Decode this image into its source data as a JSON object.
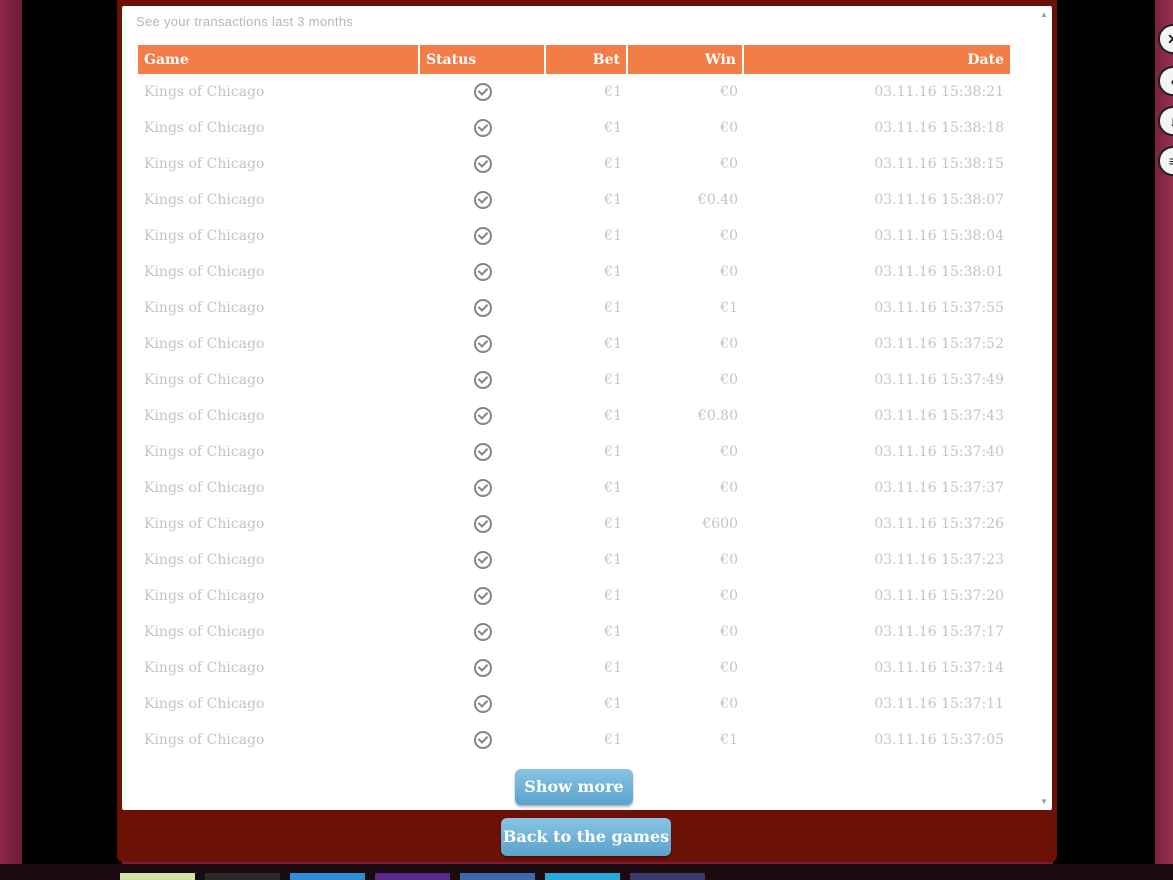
{
  "subtitle": "See your transactions last 3 months",
  "columns": {
    "game": "Game",
    "status": "Status",
    "bet": "Bet",
    "win": "Win",
    "date": "Date"
  },
  "rows": [
    {
      "game": "Kings of Chicago",
      "bet": "€1",
      "win": "€0",
      "date": "03.11.16 15:38:21"
    },
    {
      "game": "Kings of Chicago",
      "bet": "€1",
      "win": "€0",
      "date": "03.11.16 15:38:18"
    },
    {
      "game": "Kings of Chicago",
      "bet": "€1",
      "win": "€0",
      "date": "03.11.16 15:38:15"
    },
    {
      "game": "Kings of Chicago",
      "bet": "€1",
      "win": "€0.40",
      "date": "03.11.16 15:38:07"
    },
    {
      "game": "Kings of Chicago",
      "bet": "€1",
      "win": "€0",
      "date": "03.11.16 15:38:04"
    },
    {
      "game": "Kings of Chicago",
      "bet": "€1",
      "win": "€0",
      "date": "03.11.16 15:38:01"
    },
    {
      "game": "Kings of Chicago",
      "bet": "€1",
      "win": "€1",
      "date": "03.11.16 15:37:55"
    },
    {
      "game": "Kings of Chicago",
      "bet": "€1",
      "win": "€0",
      "date": "03.11.16 15:37:52"
    },
    {
      "game": "Kings of Chicago",
      "bet": "€1",
      "win": "€0",
      "date": "03.11.16 15:37:49"
    },
    {
      "game": "Kings of Chicago",
      "bet": "€1",
      "win": "€0.80",
      "date": "03.11.16 15:37:43"
    },
    {
      "game": "Kings of Chicago",
      "bet": "€1",
      "win": "€0",
      "date": "03.11.16 15:37:40"
    },
    {
      "game": "Kings of Chicago",
      "bet": "€1",
      "win": "€0",
      "date": "03.11.16 15:37:37"
    },
    {
      "game": "Kings of Chicago",
      "bet": "€1",
      "win": "€600",
      "date": "03.11.16 15:37:26"
    },
    {
      "game": "Kings of Chicago",
      "bet": "€1",
      "win": "€0",
      "date": "03.11.16 15:37:23"
    },
    {
      "game": "Kings of Chicago",
      "bet": "€1",
      "win": "€0",
      "date": "03.11.16 15:37:20"
    },
    {
      "game": "Kings of Chicago",
      "bet": "€1",
      "win": "€0",
      "date": "03.11.16 15:37:17"
    },
    {
      "game": "Kings of Chicago",
      "bet": "€1",
      "win": "€0",
      "date": "03.11.16 15:37:14"
    },
    {
      "game": "Kings of Chicago",
      "bet": "€1",
      "win": "€0",
      "date": "03.11.16 15:37:11"
    },
    {
      "game": "Kings of Chicago",
      "bet": "€1",
      "win": "€1",
      "date": "03.11.16 15:37:05"
    }
  ],
  "buttons": {
    "show_more": "Show more",
    "back": "Back to the games"
  },
  "colors": {
    "header": "#f47d47",
    "frame": "#6b1105",
    "button": "#6fb3d8"
  },
  "icons": {
    "status": "check-circle-icon"
  }
}
